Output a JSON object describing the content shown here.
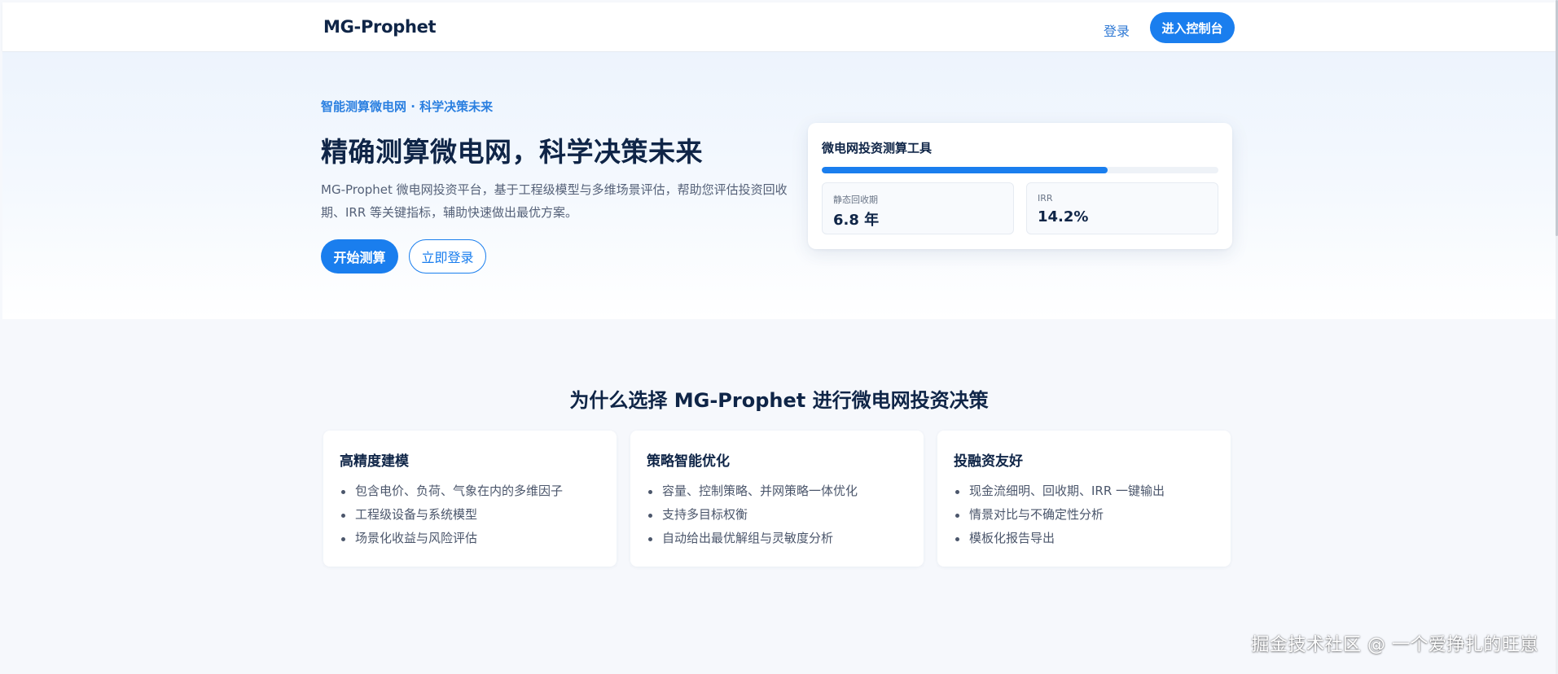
{
  "nav": {
    "brand": "MG-Prophet",
    "login": "登录",
    "console": "进入控制台"
  },
  "hero": {
    "tagline": "智能测算微电网 · 科学决策未来",
    "title": "精确测算微电网，科学决策未来",
    "description": "MG-Prophet 微电网投资平台，基于工程级模型与多维场景评估，帮助您评估投资回收期、IRR 等关键指标，辅助快速做出最优方案。",
    "start_button": "开始测算",
    "login_button": "立即登录"
  },
  "tool_card": {
    "title": "微电网投资测算工具",
    "progress": 0.72,
    "metrics": [
      {
        "label": "静态回收期",
        "value": "6.8 年"
      },
      {
        "label": "IRR",
        "value": "14.2%"
      }
    ]
  },
  "why": {
    "title": "为什么选择 MG-Prophet 进行微电网投资决策",
    "features": [
      {
        "title": "高精度建模",
        "items": [
          "包含电价、负荷、气象在内的多维因子",
          "工程级设备与系统模型",
          "场景化收益与风险评估"
        ]
      },
      {
        "title": "策略智能优化",
        "items": [
          "容量、控制策略、并网策略一体优化",
          "支持多目标权衡",
          "自动给出最优解组与灵敏度分析"
        ]
      },
      {
        "title": "投融资友好",
        "items": [
          "现金流细明、回收期、IRR 一键输出",
          "情景对比与不确定性分析",
          "模板化报告导出"
        ]
      }
    ]
  },
  "watermark": "掘金技术社区 @ 一个爱挣扎的旺崽",
  "colors": {
    "primary": "#1a7eee",
    "heading": "#0f2547",
    "background": "#f6f8fc"
  }
}
